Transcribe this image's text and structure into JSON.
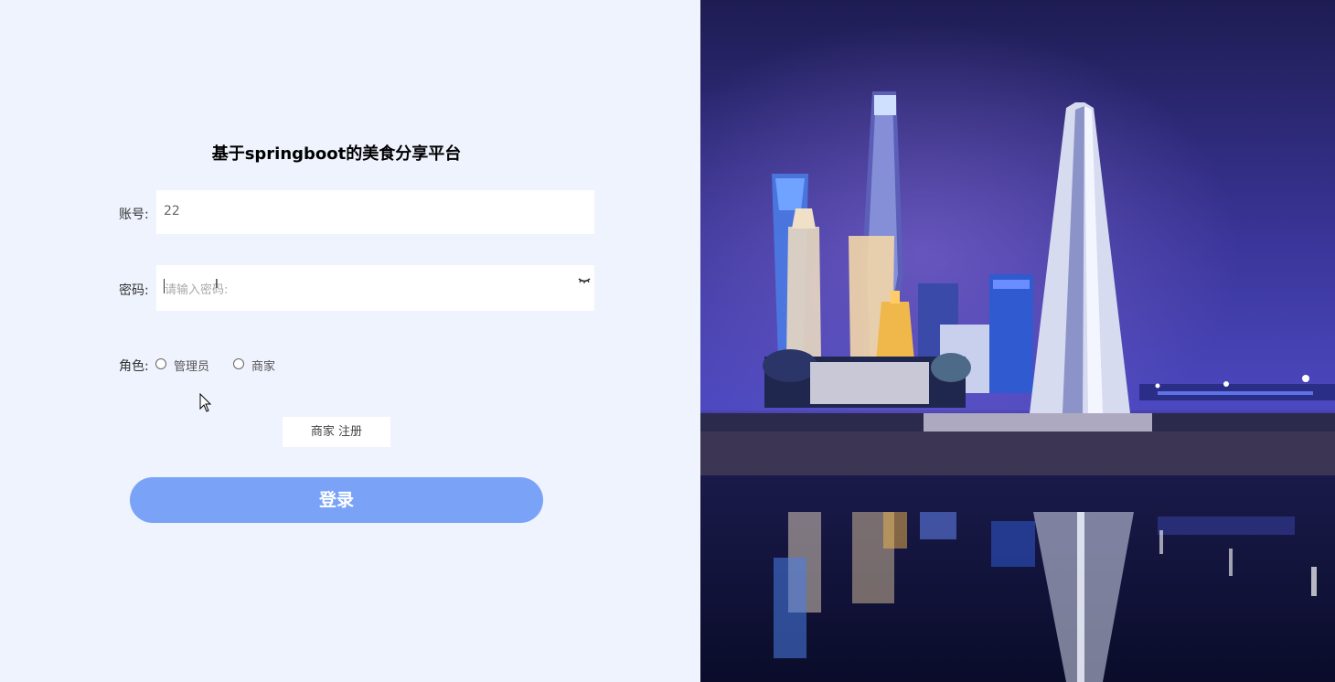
{
  "title": "基于springboot的美食分享平台",
  "account": {
    "label": "账号:",
    "value": "22"
  },
  "password": {
    "label": "密码:",
    "placeholder": "请输入密码:"
  },
  "role": {
    "label": "角色:",
    "options": [
      "管理员",
      "商家"
    ]
  },
  "register_label": "商家 注册",
  "login_label": "登录",
  "colors": {
    "background": "#eef3fe",
    "login_button": "#7aa3f7",
    "input_bg": "#ffffff"
  },
  "icons": {
    "eye": "eye-closed-icon",
    "cursor": "mouse-pointer-icon"
  }
}
